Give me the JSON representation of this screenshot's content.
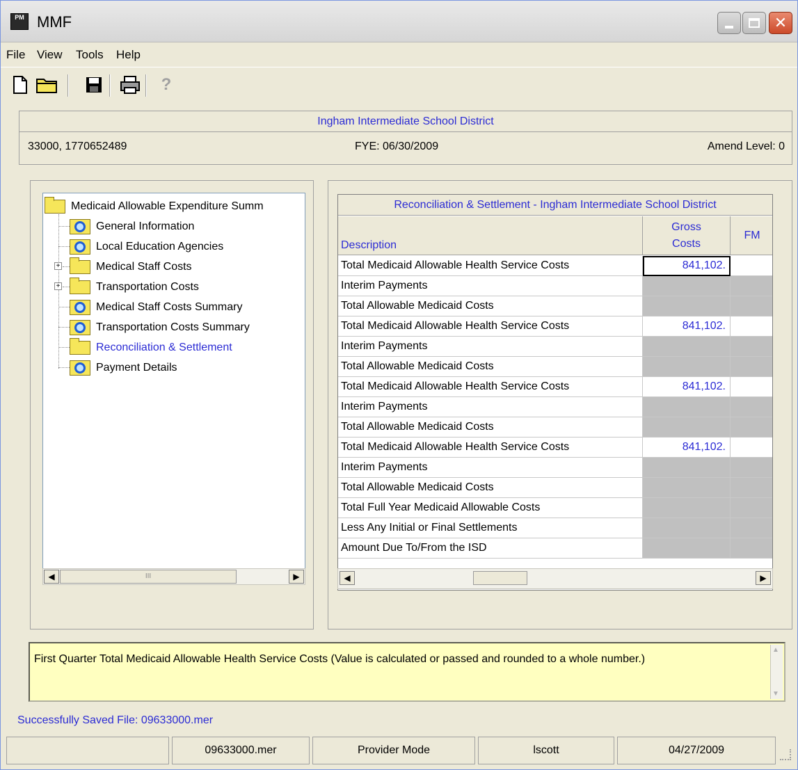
{
  "window": {
    "title": "MMF",
    "app_icon_text": "PM"
  },
  "menu": [
    "File",
    "View",
    "Tools",
    "Help"
  ],
  "toolbar": {
    "help_label": "?"
  },
  "header": {
    "district": "Ingham Intermediate School District",
    "ids": "33000, 1770652489",
    "fye": "FYE: 06/30/2009",
    "amend": "Amend Level: 0"
  },
  "tree": {
    "root": "Medicaid Allowable Expenditure Summ",
    "items": [
      {
        "label": "General Information",
        "icon": "search-doc-icon"
      },
      {
        "label": "Local Education Agencies",
        "icon": "search-doc-icon"
      },
      {
        "label": "Medical Staff Costs",
        "icon": "folder-icon"
      },
      {
        "label": "Transportation Costs",
        "icon": "folder-icon"
      },
      {
        "label": "Medical Staff Costs Summary",
        "icon": "search-doc-icon"
      },
      {
        "label": "Transportation Costs Summary",
        "icon": "search-doc-icon"
      },
      {
        "label": "Reconciliation & Settlement",
        "icon": "open-folder-icon"
      },
      {
        "label": "Payment Details",
        "icon": "search-doc-icon"
      }
    ],
    "scroll_label": "III"
  },
  "grid": {
    "title": "Reconciliation & Settlement - Ingham Intermediate School District",
    "col_desc": "Description",
    "col_gross_1": "Gross",
    "col_gross_2": "Costs",
    "col_fm": "FM",
    "rows": [
      {
        "desc": "Total Medicaid Allowable Health Service Costs",
        "gross": "841,102."
      },
      {
        "desc": "Interim Payments",
        "gross": ""
      },
      {
        "desc": "Total Allowable Medicaid Costs",
        "gross": ""
      },
      {
        "desc": "Total Medicaid Allowable Health Service Costs",
        "gross": "841,102."
      },
      {
        "desc": "Interim Payments",
        "gross": ""
      },
      {
        "desc": "Total Allowable Medicaid Costs",
        "gross": ""
      },
      {
        "desc": "Total Medicaid Allowable Health Service Costs",
        "gross": "841,102."
      },
      {
        "desc": "Interim Payments",
        "gross": ""
      },
      {
        "desc": "Total Allowable Medicaid Costs",
        "gross": ""
      },
      {
        "desc": "Total Medicaid Allowable Health Service Costs",
        "gross": "841,102."
      },
      {
        "desc": "Interim Payments",
        "gross": ""
      },
      {
        "desc": "Total Allowable Medicaid Costs",
        "gross": ""
      },
      {
        "desc": "Total Full Year Medicaid Allowable Costs",
        "gross": ""
      },
      {
        "desc": "Less Any Initial or Final Settlements",
        "gross": ""
      },
      {
        "desc": "Amount Due To/From the ISD",
        "gross": ""
      }
    ]
  },
  "info": "First Quarter Total Medicaid Allowable Health Service Costs (Value is calculated or passed and rounded to a whole number.)",
  "saved_message": "Successfully Saved File: 09633000.mer",
  "status": [
    "",
    "09633000.mer",
    "Provider Mode",
    "lscott",
    "04/27/2009"
  ],
  "colors": {
    "link_blue": "#2b2bd4",
    "info_bg": "#ffffc0",
    "chrome": "#ece9d8"
  }
}
